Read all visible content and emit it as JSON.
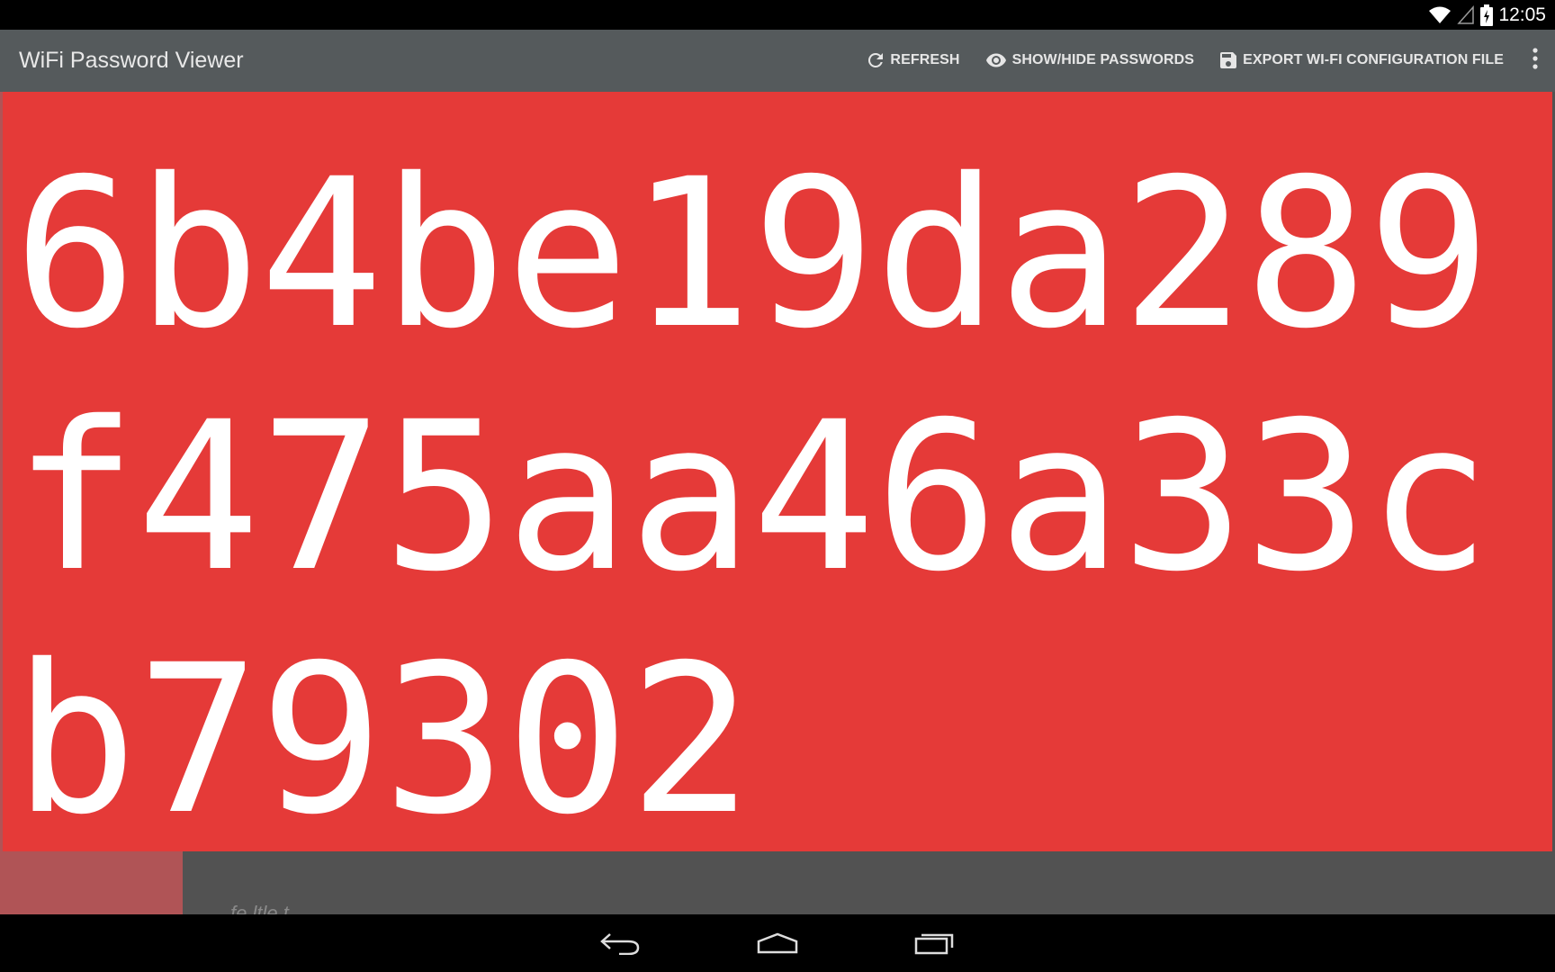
{
  "status_bar": {
    "time": "12:05",
    "icons": [
      "wifi-icon",
      "signal-icon",
      "battery-charging-icon"
    ]
  },
  "action_bar": {
    "title": "WiFi Password Viewer",
    "actions": [
      {
        "label": "REFRESH",
        "icon": "refresh-icon"
      },
      {
        "label": "SHOW/HIDE PASSWORDS",
        "icon": "eye-icon"
      },
      {
        "label": "EXPORT WI-FI CONFIGURATION FILE",
        "icon": "save-icon"
      }
    ],
    "overflow_icon": "more-vert-icon"
  },
  "password_overlay": {
    "password": "6b4be19da289f475aa46a33cb79302",
    "background_color": "#e53a38",
    "text_color": "#ffffff"
  },
  "background_content": {
    "detail_peek_text": "fe ltle t"
  },
  "nav_bar": {
    "buttons": [
      "back-icon",
      "home-icon",
      "recents-icon"
    ]
  }
}
